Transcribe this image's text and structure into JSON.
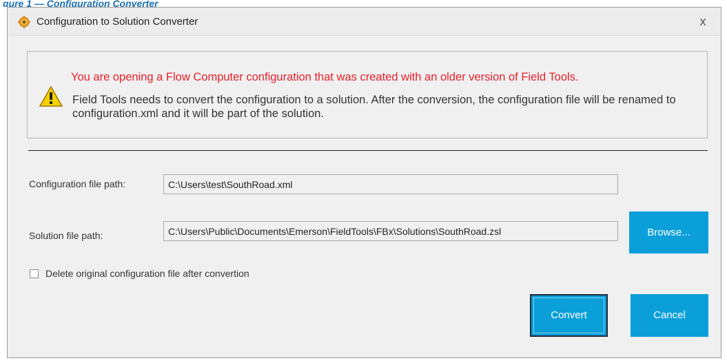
{
  "caption_fragment": "gure 1 — Configuration Converter",
  "window": {
    "title": "Configuration to Solution Converter",
    "close_label": "x"
  },
  "message": {
    "warning_line": "You are opening a Flow Computer configuration that was created with an older version of Field Tools.",
    "detail_text": "Field Tools needs to convert the configuration to a solution. After the conversion, the configuration file will be renamed to configuration.xml and it will be part of the solution."
  },
  "config_file": {
    "label": "Configuration file path:",
    "value": "C:\\Users\\test\\SouthRoad.xml"
  },
  "solution_file": {
    "label": "Solution file path:",
    "value": "C:\\Users\\Public\\Documents\\Emerson\\FieldTools\\FBx\\Solutions\\SouthRoad.zsl",
    "browse_label": "Browse..."
  },
  "delete_option": {
    "label": "Delete original configuration file after convertion",
    "checked": false
  },
  "actions": {
    "convert_label": "Convert",
    "cancel_label": "Cancel"
  },
  "colors": {
    "accent": "#0a9fd9",
    "warning_text": "#e8202a"
  }
}
